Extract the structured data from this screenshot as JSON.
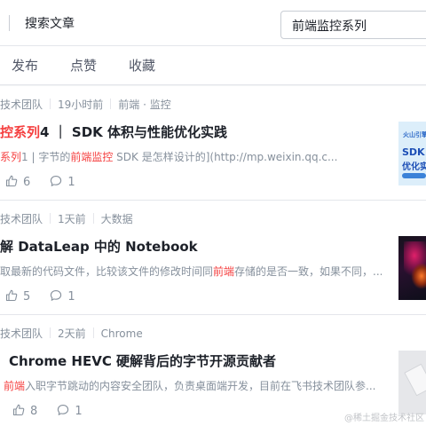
{
  "header": {
    "search_tab": "搜索文章",
    "search_value": "前端监控系列"
  },
  "filters": [
    "发布",
    "点赞",
    "收藏"
  ],
  "articles": [
    {
      "author": "技术团队",
      "time": "19小时前",
      "tags": "前端 · 监控",
      "title_highlight": "控系列",
      "title_rest": "4 ｜ SDK 体积与性能优化实践",
      "abstract_parts": [
        {
          "text": "系列",
          "hl": true
        },
        {
          "text": "1 | 字节的",
          "hl": false
        },
        {
          "text": "前端监控",
          "hl": true
        },
        {
          "text": " SDK 是怎样设计的](http://mp.weixin.qq.c...",
          "hl": false
        }
      ],
      "likes": "6",
      "comments": "1",
      "thumb": {
        "line1": "火山引擎",
        "line2": "SDK 体",
        "line3": "优化实"
      }
    },
    {
      "author": "技术团队",
      "time": "1天前",
      "tags": "大数据",
      "title_highlight": "",
      "title_rest": "解 DataLeap 中的 Notebook",
      "abstract_parts": [
        {
          "text": "取最新的代码文件，比较该文件的修改时间同",
          "hl": false
        },
        {
          "text": "前端",
          "hl": true
        },
        {
          "text": "存储的是否一致，如果不同，...",
          "hl": false
        }
      ],
      "likes": "5",
      "comments": "1"
    },
    {
      "author": "技术团队",
      "time": "2天前",
      "tags": "Chrome",
      "title_highlight": "",
      "title_rest": "Chrome HEVC 硬解背后的字节开源贡献者",
      "abstract_parts": [
        {
          "text": "前端",
          "hl": true
        },
        {
          "text": "入职字节跳动的内容安全团队，负责桌面端开发，目前在飞书技术团队参...",
          "hl": false
        }
      ],
      "likes": "8",
      "comments": "1"
    }
  ],
  "watermark": "@稀土掘金技术社区",
  "colors": {
    "highlight": "#f53f3f",
    "muted": "#86909c",
    "text": "#1d2129"
  }
}
